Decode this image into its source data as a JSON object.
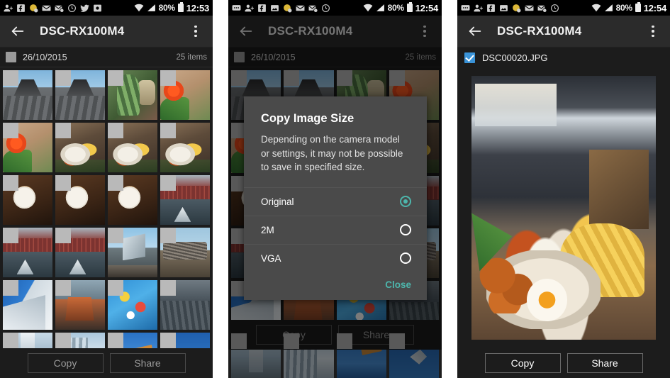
{
  "colors": {
    "accent_teal": "#4DB6AC",
    "checkbox_blue": "#3a93d8",
    "actionbar_bg": "#2b2b2b",
    "panel_bg": "#1c1c1c",
    "dialog_bg": "#4a4a4a",
    "statusbar_bg": "#000000"
  },
  "panels": [
    {
      "id": "panel-grid",
      "statusbar": {
        "icons": [
          "person-add-icon",
          "facebook-icon",
          "sticker-icon",
          "mail-icon",
          "mail-off-icon",
          "clock-icon",
          "twitter-icon",
          "photo-app-icon"
        ],
        "wifi": "wifi-icon",
        "signal": "signal-icon",
        "battery_percent": "80%",
        "battery": "battery-icon",
        "clock": "12:53"
      },
      "actionbar": {
        "back": "back-arrow-icon",
        "title": "DSC-RX100M4",
        "overflow": "overflow-menu-icon"
      },
      "date_header": {
        "checkbox_checked": false,
        "date": "26/10/2015",
        "count": "25 items"
      },
      "bottom": {
        "copy_label": "Copy",
        "share_label": "Share",
        "enabled": false
      }
    },
    {
      "id": "panel-dialog",
      "statusbar": {
        "icons": [
          "messages-icon",
          "person-add-icon",
          "facebook-icon",
          "photo-icon",
          "sticker-icon",
          "mail-icon",
          "mail-off-icon",
          "clock-icon"
        ],
        "wifi": "wifi-icon",
        "signal": "signal-icon",
        "battery_percent": "80%",
        "battery": "battery-icon",
        "clock": "12:54"
      },
      "actionbar": {
        "back": "back-arrow-icon",
        "title": "DSC-RX100M4",
        "overflow": "overflow-menu-icon"
      },
      "date_header": {
        "checkbox_checked": false,
        "date": "26/10/2015",
        "count": "25 items"
      },
      "dialog": {
        "title": "Copy Image Size",
        "message": "Depending on the camera model or settings, it may not be possible to save in specified size.",
        "options": [
          {
            "label": "Original",
            "selected": true
          },
          {
            "label": "2M",
            "selected": false
          },
          {
            "label": "VGA",
            "selected": false
          }
        ],
        "close_label": "Close"
      },
      "bottom": {
        "copy_label": "Copy",
        "share_label": "Share",
        "enabled": false
      }
    },
    {
      "id": "panel-detail",
      "statusbar": {
        "icons": [
          "messages-icon",
          "person-add-icon",
          "facebook-icon",
          "photo-icon",
          "sticker-icon",
          "mail-icon",
          "mail-off-icon",
          "clock-icon"
        ],
        "wifi": "wifi-icon",
        "signal": "signal-icon",
        "battery_percent": "80%",
        "battery": "battery-icon",
        "clock": "12:54"
      },
      "actionbar": {
        "back": "back-arrow-icon",
        "title": "DSC-RX100M4",
        "overflow": "overflow-menu-icon"
      },
      "file_header": {
        "checkbox_checked": true,
        "filename": "DSC00020.JPG"
      },
      "bottom": {
        "copy_label": "Copy",
        "share_label": "Share",
        "enabled": true
      }
    }
  ],
  "thumbnails": [
    "cathedral",
    "cathedral",
    "cactus",
    "flower",
    "flower",
    "breakfast",
    "breakfast",
    "breakfast",
    "latte",
    "latte",
    "latte",
    "dock",
    "dock",
    "dock",
    "museum",
    "locks",
    "modern",
    "dockboat",
    "sculpture",
    "road",
    "tower",
    "glass",
    "crane",
    "bird"
  ]
}
